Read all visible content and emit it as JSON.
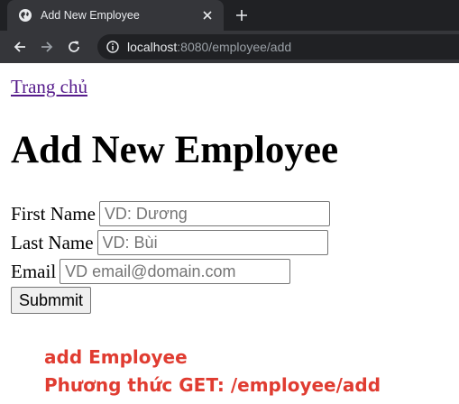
{
  "browser": {
    "tab_title": "Add New Employee",
    "url_host": "localhost",
    "url_rest": ":8080/employee/add"
  },
  "page": {
    "home_link": "Trang chủ",
    "heading": "Add New Employee",
    "form": {
      "first_name_label": "First Name",
      "first_name_placeholder": "VD: Dương",
      "last_name_label": "Last Name",
      "last_name_placeholder": "VD: Bùi",
      "email_label": "Email",
      "email_placeholder": "VD email@domain.com",
      "submit_label": "Submmit"
    }
  },
  "annotation": {
    "line1": "add Employee",
    "line2": "Phương thức GET:  /employee/add",
    "color": "#e03c31"
  },
  "icons": [
    "globe-icon",
    "close-icon",
    "plus-icon",
    "back-arrow-icon",
    "forward-arrow-icon",
    "reload-icon",
    "info-icon"
  ]
}
